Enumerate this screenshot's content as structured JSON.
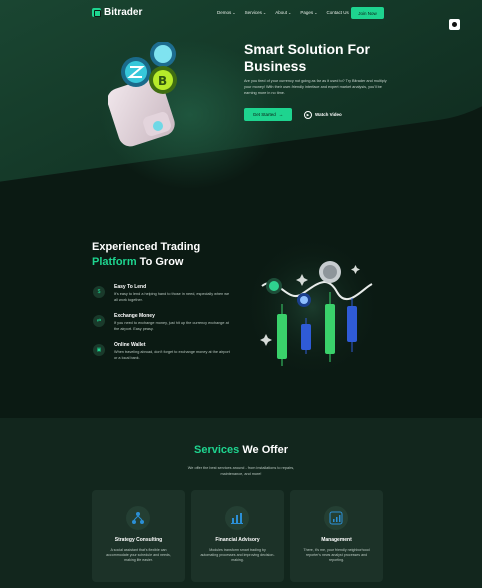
{
  "nav": {
    "brand": "Bitrader",
    "items": [
      {
        "label": "Demos"
      },
      {
        "label": "Services"
      },
      {
        "label": "About"
      },
      {
        "label": "Pages"
      },
      {
        "label": "Contact Us"
      }
    ],
    "join_label": "Join Now",
    "chevron": "⌄"
  },
  "hero": {
    "title_line1": "Smart Solution For",
    "title_line2": "Business",
    "description": "Are you tired of your currency not going as far as it used to? Try Bitrader and multiply your money! With their user-friendly interface and expert market analysis, you'll be earning more in no time.",
    "start_label": "Get Started",
    "start_arrow": "→",
    "play_icon": "▶",
    "video_label": "Watch Video"
  },
  "trading": {
    "title_line1": "Experienced Trading",
    "title_accent": "Platform",
    "title_rest": " To Grow",
    "features": [
      {
        "icon": "$",
        "title": "Easy To Lend",
        "desc": "It's easy to lend a helping hand to those in need, especially when we all work together."
      },
      {
        "icon": "⇄",
        "title": "Exchange Money",
        "desc": "If you need to exchange money, just hit up the currency exchange at the airport. Easy peasy."
      },
      {
        "icon": "▣",
        "title": "Online Wallet",
        "desc": "When traveling abroad, don't forget to exchange money at the airport or a local bank."
      }
    ]
  },
  "services": {
    "title_accent": "Services",
    "title_rest": " We Offer",
    "description": "We offer the best services around - from installations to repairs, maintenance, and more!",
    "cards": [
      {
        "title": "Strategy Consulting",
        "desc": "A social assistant that's flexible can accommodate your schedule and needs, making life easier."
      },
      {
        "title": "Financial Advisory",
        "desc": "Modules transform smart trading by automating processes and improving decision-making."
      },
      {
        "title": "Management",
        "desc": "There, it's me, your friendly neighborhood reporter's news analyst processes and reporting."
      }
    ]
  },
  "colors": {
    "accent": "#1ed48f",
    "background": "#0b1a13",
    "card": "#1c3228"
  }
}
